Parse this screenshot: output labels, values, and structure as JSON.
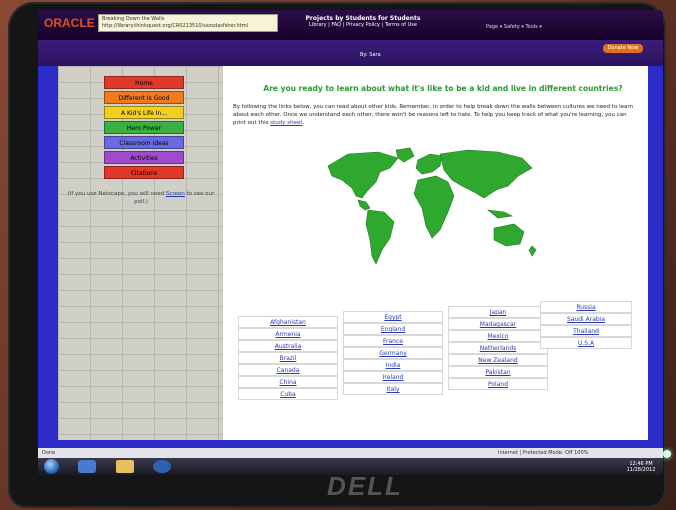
{
  "browser": {
    "logo": "ORACLE",
    "tooltip_title": "Breaking Down the Walls",
    "tooltip_url": "http://library.thinkquest.org/CR0213510/sxzsdasfsher.html",
    "site_title": "Projects by Students for Students",
    "site_links": "Library | FAQ | Privacy Policy | Terms of Use",
    "donate": "Donate Now",
    "by_line": "By: Sara",
    "toolbar": "Page ▾  Safety ▾  Tools ▾"
  },
  "nav": {
    "items": [
      {
        "label": "Home",
        "color": "#e0382a"
      },
      {
        "label": "Different Is Good",
        "color": "#f07a20"
      },
      {
        "label": "A Kid's Life In...",
        "color": "#f0d020"
      },
      {
        "label": "Hero Power",
        "color": "#3ab040"
      },
      {
        "label": "Classroom Ideas",
        "color": "#6a6ae0"
      },
      {
        "label": "Activities",
        "color": "#a04ad0"
      },
      {
        "label": "Citations",
        "color": "#e0382a"
      }
    ],
    "note_pre": "(If you use Netscape, you will need",
    "note_link": "Screen",
    "note_post": "to see our poll.)"
  },
  "main": {
    "heading": "Are you ready to learn about what it's like to be a kid and live in different countries?",
    "intro": "By following the links below, you can read about other kids. Remember, in order to help break down the walls between cultures we need to learn about each other.  Once we understand each other, there won't be reasons left to hate.  To help you keep track of what you're learning, you can print out this",
    "intro_link": "study sheet",
    "intro_end": "."
  },
  "countries": {
    "col1": [
      "Afghanistan",
      "Armenia",
      "Australia",
      "Brazil",
      "Canada",
      "China",
      "Cuba"
    ],
    "col2": [
      "Egypt",
      "England",
      "France",
      "Germany",
      "India",
      "Ireland",
      "Italy"
    ],
    "col3": [
      "Japan",
      "Madagascar",
      "Mexico",
      "Netherlands",
      "New Zealand",
      "Pakistan",
      "Poland"
    ],
    "col4": [
      "Russia",
      "Saudi Arabia",
      "Thailand",
      "U.S.A"
    ]
  },
  "status": {
    "done": "Done",
    "zone": "Internet | Protected Mode: Off",
    "zoom": "100%",
    "time": "12:46 PM",
    "date": "11/28/2012"
  },
  "monitor": {
    "brand": "DELL"
  },
  "colors": {
    "screen_bg": "#2b2bc8",
    "heading": "#2a9a30",
    "link": "#2a3ab0",
    "land": "#2fa82f"
  }
}
